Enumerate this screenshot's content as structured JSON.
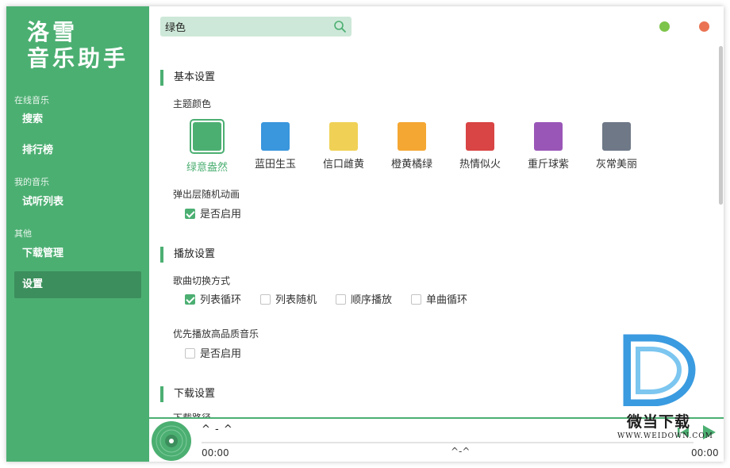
{
  "app": {
    "logo_line1": "洛雪",
    "logo_line2": "音乐助手"
  },
  "sidebar": {
    "groups": [
      {
        "label": "在线音乐",
        "items": [
          {
            "label": "搜索"
          },
          {
            "label": "排行榜"
          }
        ]
      },
      {
        "label": "我的音乐",
        "items": [
          {
            "label": "试听列表"
          }
        ]
      },
      {
        "label": "其他",
        "items": [
          {
            "label": "下载管理"
          },
          {
            "label": "设置"
          }
        ]
      }
    ],
    "active_item": "设置"
  },
  "search": {
    "value": "绿色"
  },
  "settings": {
    "basic": {
      "title": "基本设置",
      "theme_label": "主题颜色",
      "themes": [
        {
          "label": "绿意盎然",
          "color": "#4caf72",
          "selected": true
        },
        {
          "label": "蓝田生玉",
          "color": "#3a96dd",
          "selected": false
        },
        {
          "label": "信口雌黄",
          "color": "#f0d155",
          "selected": false
        },
        {
          "label": "橙黄橘绿",
          "color": "#f5a733",
          "selected": false
        },
        {
          "label": "热情似火",
          "color": "#d94444",
          "selected": false
        },
        {
          "label": "重斤球紫",
          "color": "#9a56b7",
          "selected": false
        },
        {
          "label": "灰常美丽",
          "color": "#6e7887",
          "selected": false
        }
      ],
      "popup_anim_label": "弹出层随机动画",
      "popup_anim_option": "是否启用",
      "popup_anim_checked": true
    },
    "playback": {
      "title": "播放设置",
      "switch_label": "歌曲切换方式",
      "switch_options": [
        {
          "label": "列表循环",
          "checked": true
        },
        {
          "label": "列表随机",
          "checked": false
        },
        {
          "label": "顺序播放",
          "checked": false
        },
        {
          "label": "单曲循环",
          "checked": false
        }
      ],
      "hq_label": "优先播放高品质音乐",
      "hq_option": "是否启用",
      "hq_checked": false
    },
    "download": {
      "title": "下载设置",
      "path_label": "下载路径"
    }
  },
  "player": {
    "title": "^ - ^",
    "time_current": "00:00",
    "center_text": "^-^",
    "time_total": "00:00",
    "progress": 0
  },
  "watermark": {
    "name": "微当下载",
    "url": "WWW.WEIDOWN.COM"
  }
}
